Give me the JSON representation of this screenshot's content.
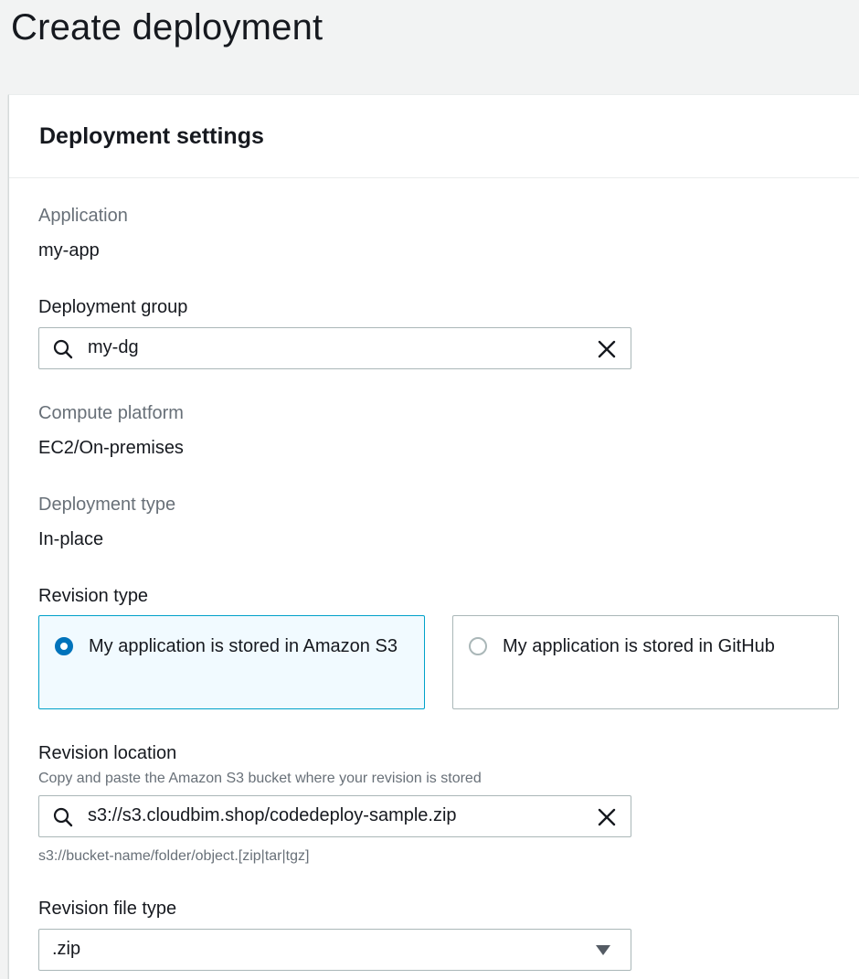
{
  "page": {
    "title": "Create deployment"
  },
  "panel": {
    "title": "Deployment settings"
  },
  "application": {
    "label": "Application",
    "value": "my-app"
  },
  "deployment_group": {
    "label": "Deployment group",
    "value": "my-dg",
    "search_icon": "search-icon",
    "clear_icon": "close-icon"
  },
  "compute_platform": {
    "label": "Compute platform",
    "value": "EC2/On-premises"
  },
  "deployment_type": {
    "label": "Deployment type",
    "value": "In-place"
  },
  "revision_type": {
    "label": "Revision type",
    "options": [
      {
        "label": "My application is stored in Amazon S3",
        "selected": true
      },
      {
        "label": "My application is stored in GitHub",
        "selected": false
      }
    ]
  },
  "revision_location": {
    "label": "Revision location",
    "description": "Copy and paste the Amazon S3 bucket where your revision is stored",
    "value": "s3://s3.cloudbim.shop/codedeploy-sample.zip",
    "hint": "s3://bucket-name/folder/object.[zip|tar|tgz]"
  },
  "revision_file_type": {
    "label": "Revision file type",
    "value": ".zip"
  },
  "colors": {
    "accent": "#0073bb",
    "selected_border": "#00a1c9",
    "selected_bg": "#f1faff",
    "muted_text": "#687078"
  }
}
